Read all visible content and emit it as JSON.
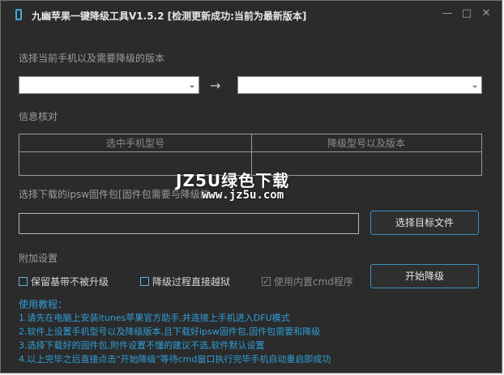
{
  "window": {
    "title": "九幽苹果一键降级工具V1.5.2 [检测更新成功:当前为最新版本]",
    "min": "—",
    "max": "□",
    "close": "✕"
  },
  "select_section": {
    "label": "选择当前手机以及需要降级的版本",
    "arrow_between": "→",
    "combo_arrow": "⌄"
  },
  "info_section": {
    "label": "信息核对",
    "col_model": "选中手机型号",
    "col_downgrade": "降级型号以及版本"
  },
  "firmware_section": {
    "label": "选择下载的ipsw固件包[固件包需要与降级的",
    "select_button": "选择目标文件"
  },
  "options_section": {
    "label": "附加设置",
    "opt_keep_baseband": "保留基带不被升级",
    "opt_jailbreak": "降级过程直接越狱",
    "opt_builtin_cmd": "使用内置cmd程序",
    "opt_builtin_cmd_checked": true,
    "start_button": "开始降级"
  },
  "tutorial": {
    "title": "使用教程：",
    "steps": [
      "1.请先在电脑上安装itunes苹果官方助手,并连接上手机进入DFU模式",
      "2.软件上设置手机型号以及降级版本,且下载好ipsw固件包,固件包需要和降级",
      "3.选择下载好的固件包,附件设置不懂的建议不选,软件默认设置",
      "4.以上完毕之后直接点击\"开始降级\"等待cmd窗口执行完毕手机自动重启即成功"
    ]
  },
  "watermark": {
    "line1": "JZ5U绿色下载",
    "line2": "www.jz5u.com"
  }
}
